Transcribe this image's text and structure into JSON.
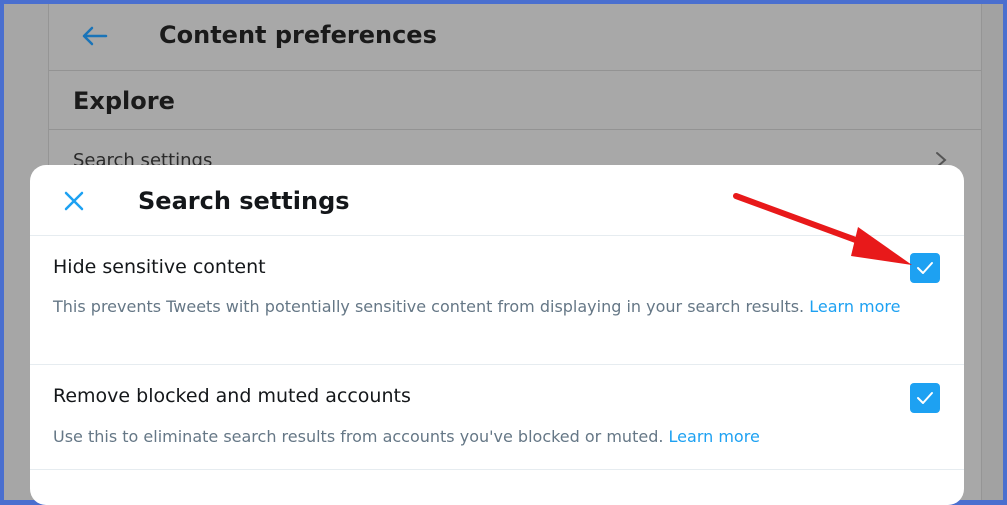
{
  "background": {
    "header_title": "Content preferences",
    "section_title": "Explore",
    "row_label": "Search settings"
  },
  "modal": {
    "title": "Search settings",
    "settings": [
      {
        "label": "Hide sensitive content",
        "description": "This prevents Tweets with potentially sensitive content from displaying in your search results.",
        "link": "Learn more",
        "checked": true
      },
      {
        "label": "Remove blocked and muted accounts",
        "description": "Use this to eliminate search results from accounts you've blocked or muted.",
        "link": "Learn more",
        "checked": true
      }
    ]
  },
  "icons": {
    "back": "arrow-left-icon",
    "close": "close-icon",
    "chevron": "chevron-right-icon",
    "check": "checkmark-icon"
  },
  "colors": {
    "accent": "#1da1f2",
    "annotation_arrow": "#e8191a",
    "overlay_gray": "#a8a8a8",
    "frame_border": "#4a6fcf"
  }
}
